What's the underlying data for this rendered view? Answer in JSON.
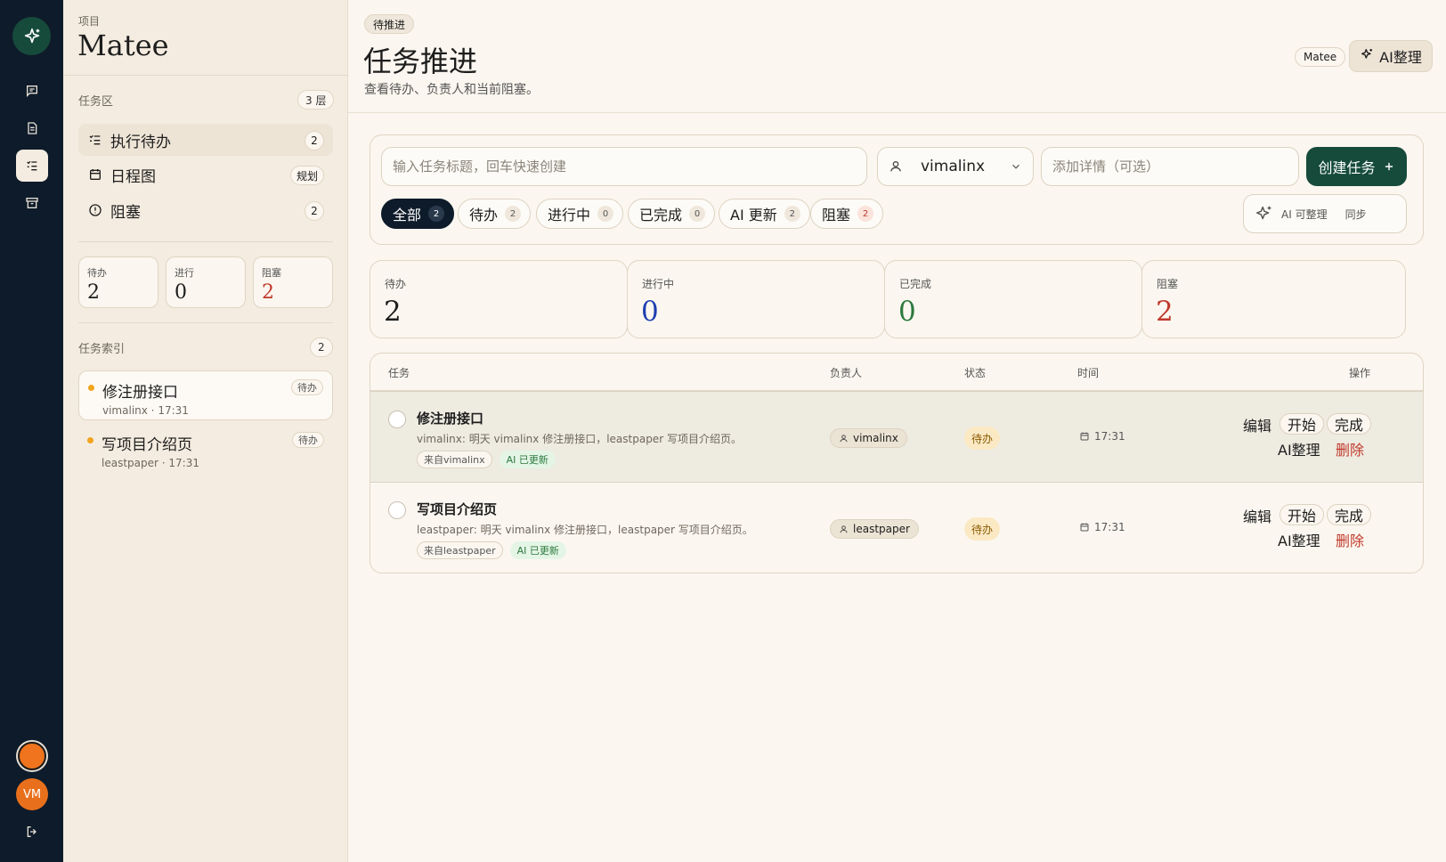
{
  "rail": {
    "avatar_initials": "VM"
  },
  "sidebar": {
    "project_label": "项目",
    "project_name": "Matee",
    "task_area": {
      "title": "任务区",
      "badge": "3 层"
    },
    "nav": [
      {
        "label": "执行待办",
        "badge": "2",
        "icon": "checklist-icon"
      },
      {
        "label": "日程图",
        "badge": "规划",
        "icon": "calendar-icon"
      },
      {
        "label": "阻塞",
        "badge": "2",
        "icon": "alert-circle-icon"
      }
    ],
    "mini_stats": [
      {
        "label": "待办",
        "value": "2",
        "color": "#1d1d1d"
      },
      {
        "label": "进行",
        "value": "0",
        "color": "#1d1d1d"
      },
      {
        "label": "阻塞",
        "value": "2",
        "color": "#c0392b"
      }
    ],
    "index": {
      "title": "任务索引",
      "badge": "2",
      "items": [
        {
          "title": "修注册接口",
          "owner": "vimalinx",
          "time": "17:31",
          "tag": "待办"
        },
        {
          "title": "写项目介绍页",
          "owner": "leastpaper",
          "time": "17:31",
          "tag": "待办"
        }
      ]
    }
  },
  "header": {
    "pill": "待推进",
    "title": "任务推进",
    "subtitle": "查看待办、负责人和当前阻塞。",
    "project_tag": "Matee",
    "ai_button": "AI整理"
  },
  "composer": {
    "title_placeholder": "输入任务标题，回车快速创建",
    "assignee": "vimalinx",
    "detail_placeholder": "添加详情（可选）",
    "create_button": "创建任务",
    "tabs": [
      {
        "label": "全部",
        "count": "2"
      },
      {
        "label": "待办",
        "count": "2"
      },
      {
        "label": "进行中",
        "count": "0"
      },
      {
        "label": "已完成",
        "count": "0"
      },
      {
        "label": "AI 更新",
        "count": "2"
      },
      {
        "label": "阻塞",
        "count": "2"
      }
    ],
    "ai_sync": {
      "label": "AI 可整理",
      "action": "同步"
    }
  },
  "stats": [
    {
      "label": "待办",
      "value": "2",
      "color": "#1d1d1d"
    },
    {
      "label": "进行中",
      "value": "0",
      "color": "#1f3fb0"
    },
    {
      "label": "已完成",
      "value": "0",
      "color": "#2d7a3f"
    },
    {
      "label": "阻塞",
      "value": "2",
      "color": "#c0392b"
    }
  ],
  "table": {
    "headers": {
      "task": "任务",
      "owner": "负责人",
      "status": "状态",
      "time": "时间",
      "actions": "操作"
    },
    "rows": [
      {
        "title": "修注册接口",
        "desc": "vimalinx: 明天 vimalinx 修注册接口，leastpaper 写项目介绍页。",
        "source_tag": "来自vimalinx",
        "ai_tag": "AI 已更新",
        "owner": "vimalinx",
        "status": "待办",
        "time": "17:31",
        "actions": {
          "edit": "编辑",
          "start": "开始",
          "done": "完成",
          "ai": "AI整理",
          "delete": "删除"
        }
      },
      {
        "title": "写项目介绍页",
        "desc": "leastpaper: 明天 vimalinx 修注册接口，leastpaper 写项目介绍页。",
        "source_tag": "来自leastpaper",
        "ai_tag": "AI 已更新",
        "owner": "leastpaper",
        "status": "待办",
        "time": "17:31",
        "actions": {
          "edit": "编辑",
          "start": "开始",
          "done": "完成",
          "ai": "AI整理",
          "delete": "删除"
        }
      }
    ]
  }
}
